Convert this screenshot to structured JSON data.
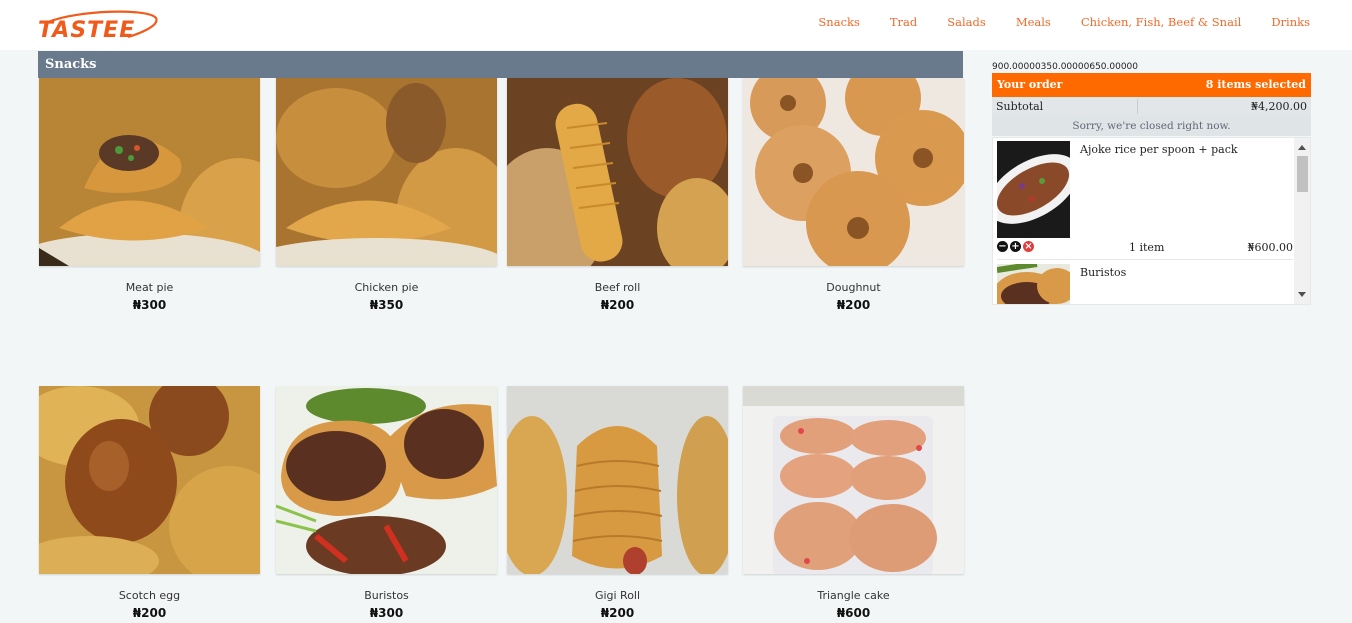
{
  "brand": {
    "name": "TASTEE"
  },
  "nav": {
    "items": [
      "Snacks",
      "Trad",
      "Salads",
      "Meals",
      "Chicken, Fish, Beef & Snail",
      "Drinks"
    ]
  },
  "section": {
    "title": "Snacks"
  },
  "products": [
    {
      "name": "Meat pie",
      "price": "₦300",
      "image": "meat-pie"
    },
    {
      "name": "Chicken pie",
      "price": "₦350",
      "image": "chicken-pie"
    },
    {
      "name": "Beef roll",
      "price": "₦200",
      "image": "beef-roll"
    },
    {
      "name": "Doughnut",
      "price": "₦200",
      "image": "doughnut"
    },
    {
      "name": "Scotch egg",
      "price": "₦200",
      "image": "scotch-egg"
    },
    {
      "name": "Buristos",
      "price": "₦300",
      "image": "buristos"
    },
    {
      "name": "Gigi Roll",
      "price": "₦200",
      "image": "gigi-roll"
    },
    {
      "name": "Triangle cake",
      "price": "₦600",
      "image": "triangle-cake"
    }
  ],
  "order": {
    "debug_text": "900.00000350.00000650.00000",
    "title": "Your order",
    "items_selected": "8 items selected",
    "subtotal_label": "Subtotal",
    "subtotal_value": "₦4,200.00",
    "closed_message": "Sorry, we're closed right now.",
    "items": [
      {
        "name": "Ajoke rice per spoon + pack",
        "qty": "1 item",
        "price": "₦600.00"
      },
      {
        "name": "Buristos",
        "qty": "",
        "price": ""
      }
    ]
  },
  "colors": {
    "accent": "#ff6a00",
    "nav_text": "#f06a2c",
    "section_bar": "#697a8c"
  }
}
